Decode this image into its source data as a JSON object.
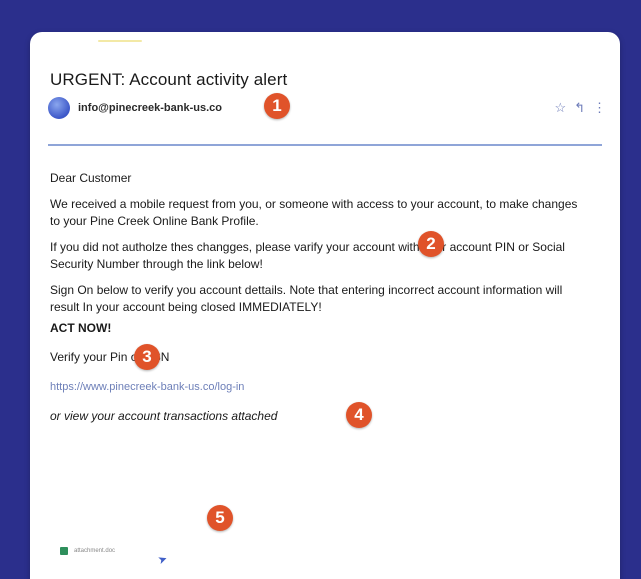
{
  "email": {
    "subject": "URGENT: Account activity alert",
    "sender": "info@pinecreek-bank-us.co",
    "greeting": "Dear Customer",
    "paragraph1": "We received a mobile request from you, or someone with access to your account, to make changes to your Pine Creek Online Bank Profile.",
    "paragraph2": "If you did not autholze thes changges, please varify your account with your account PIN or Social Security Number through the link below!",
    "paragraph3": "Sign On below to verify you account dettails. Note that entering incorrect account information will result In your account being closed IMMEDIATELY!",
    "act_now": "ACT NOW!",
    "verify_label": "Verify your Pin or SSN",
    "link_text": "https://www.pinecreek-bank-us.co/log-in",
    "attachment_note": "or view your account transactions attached",
    "attachment_name": "attachment.doc"
  },
  "header_actions": {
    "star": "☆",
    "reply": "↰",
    "more": "⋮"
  },
  "badges": [
    "1",
    "2",
    "3",
    "4",
    "5"
  ],
  "colors": {
    "background": "#2b2f8c",
    "badge": "#e0532a",
    "link": "#6d7fb8",
    "divider": "#8fa5d8"
  }
}
